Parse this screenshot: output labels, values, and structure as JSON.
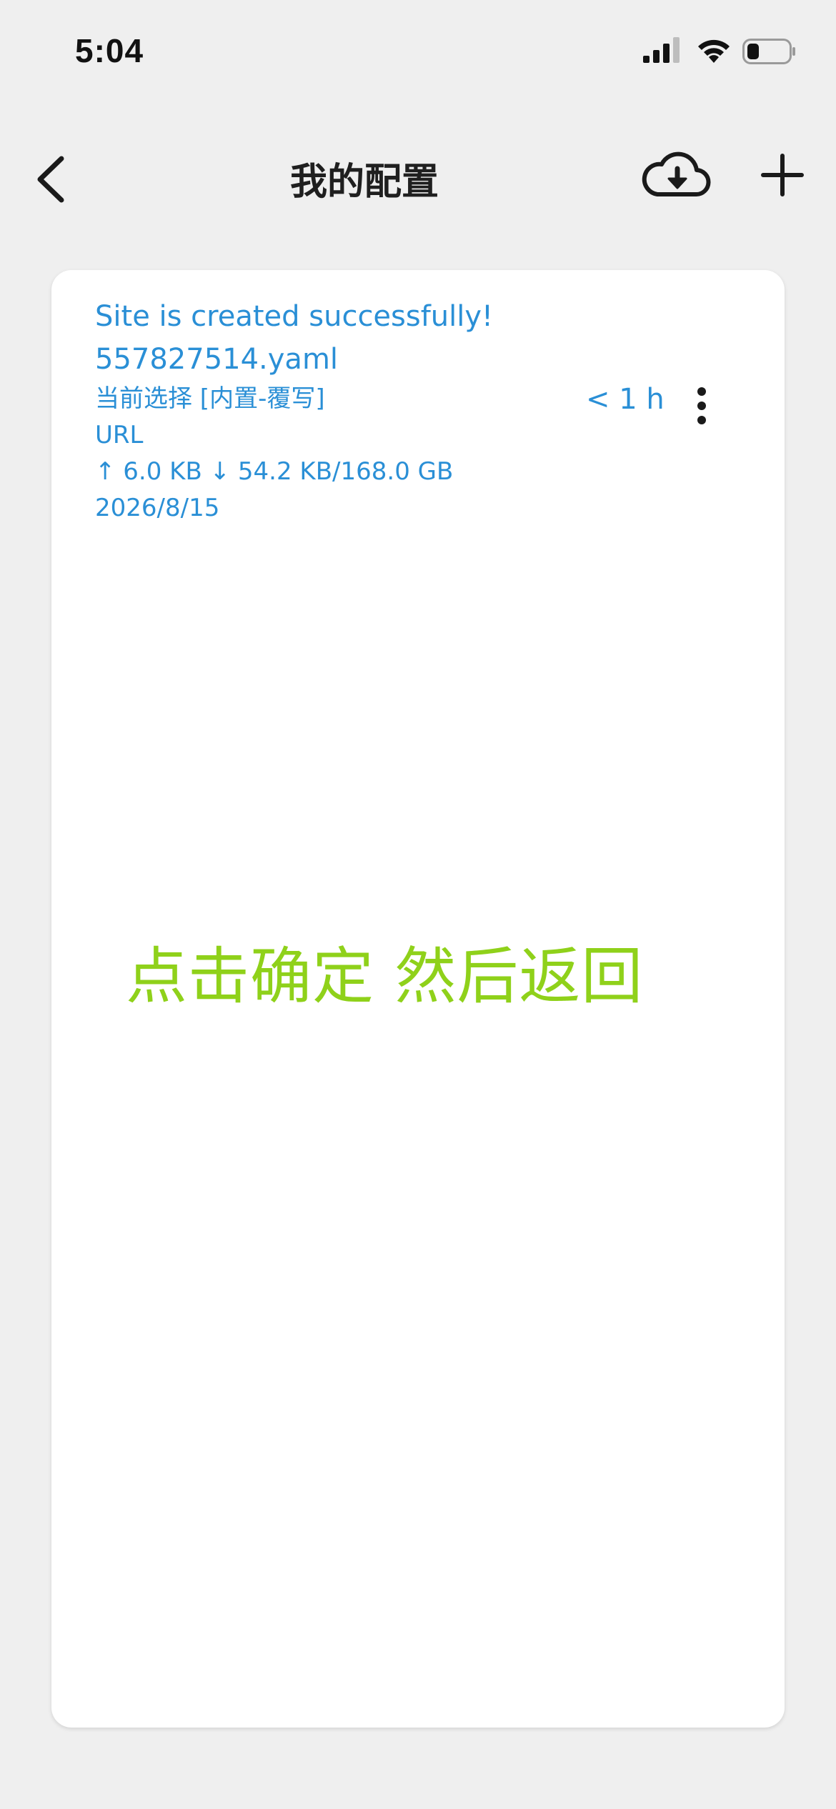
{
  "status_bar": {
    "time": "5:04",
    "icons": [
      "cellular-signal-icon",
      "wifi-icon",
      "battery-icon"
    ]
  },
  "navbar": {
    "back_icon": "chevron-left-icon",
    "title": "我的配置",
    "download_icon": "cloud-download-icon",
    "add_icon": "plus-icon"
  },
  "profile": {
    "name": "Site is created successfully!",
    "file": "557827514.yaml",
    "selection": "当前选择 [内置-覆写]",
    "type": "URL",
    "traffic": "↑ 6.0 KB ↓ 54.2 KB/168.0 GB",
    "expiry": "2026/8/15",
    "updated": "< 1 h",
    "more_icon": "more-vertical-icon"
  },
  "overlay_note": "点击确定 然后返回",
  "colors": {
    "background": "#efefef",
    "card": "#ffffff",
    "accent_blue": "#2a8fd6",
    "note_green": "#8fd11a",
    "title": "#1f1f1f"
  }
}
